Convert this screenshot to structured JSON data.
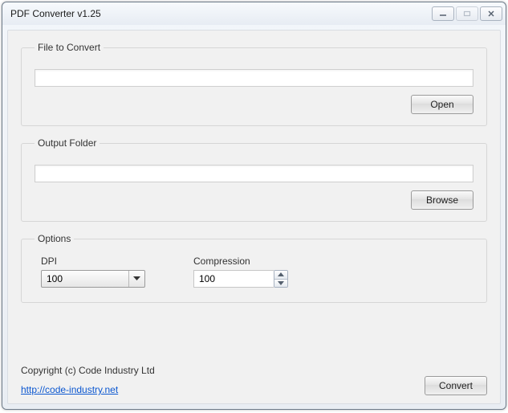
{
  "window": {
    "title": "PDF Converter v1.25"
  },
  "groups": {
    "file": {
      "legend": "File to Convert",
      "input_value": "",
      "open_label": "Open"
    },
    "output": {
      "legend": "Output Folder",
      "input_value": "",
      "browse_label": "Browse"
    },
    "options": {
      "legend": "Options",
      "dpi_label": "DPI",
      "dpi_value": "100",
      "compression_label": "Compression",
      "compression_value": "100"
    }
  },
  "footer": {
    "copyright": "Copyright (c) Code Industry Ltd",
    "link_text": "http://code-industry.net",
    "convert_label": "Convert"
  }
}
